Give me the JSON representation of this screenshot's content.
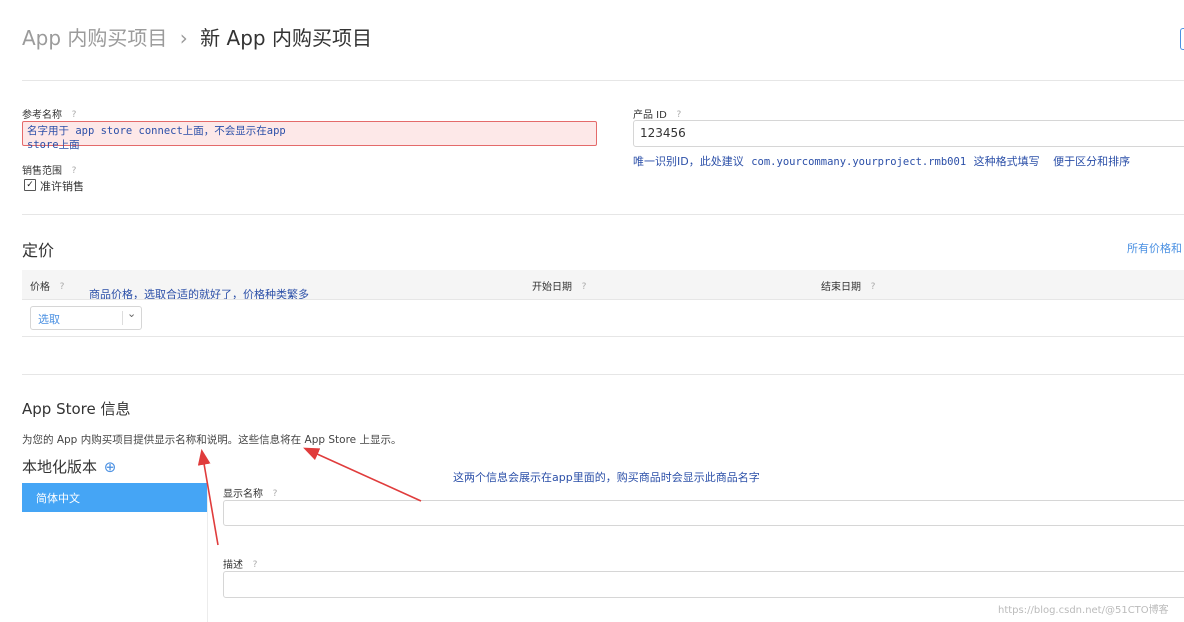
{
  "header": {
    "breadcrumb_parent": "App 内购买项目",
    "breadcrumb_sep": "›",
    "title": "新 App 内购买项目"
  },
  "reference": {
    "label": "参考名称",
    "value_line1": "名字用于 app store connect上面，不会显示在app",
    "value_line2": "store上面"
  },
  "sales": {
    "label": "销售范围",
    "checkbox_label": "准许销售",
    "checked": true
  },
  "product": {
    "label": "产品 ID",
    "value": "123456",
    "note_a": "唯一识别ID，此处建议",
    "note_b": "com.yourcommany.yourproject.rmb001",
    "note_c": "这种格式填写",
    "note_d": "便于区分和排序"
  },
  "pricing": {
    "title": "定价",
    "link": "所有价格和",
    "col_price": "价格",
    "col_start": "开始日期",
    "col_end": "结束日期",
    "price_annotation": "商品价格，选取合适的就好了，价格种类繁多",
    "select_value": "选取"
  },
  "appstore": {
    "title": "App Store 信息",
    "description": "为您的 App 内购买项目提供显示名称和说明。这些信息将在 App Store 上显示。",
    "localization_title": "本地化版本",
    "locale_item": "简体中文",
    "display_name_label": "显示名称",
    "desc_label": "描述",
    "annotation": "这两个信息会展示在app里面的，购买商品时会显示此商品名字"
  },
  "watermark": "https://blog.csdn.net/@51CTO博客",
  "colors": {
    "accent": "#4a90e2",
    "locale_bg": "#45a5f5",
    "highlight_bg": "#fde8e8",
    "highlight_border": "#e46a6a",
    "annotation": "#2b4fa8",
    "arrow": "#e03c3c"
  },
  "icons": {
    "help": "?",
    "add": "⊕",
    "caret": "⌄",
    "check": "✓"
  }
}
